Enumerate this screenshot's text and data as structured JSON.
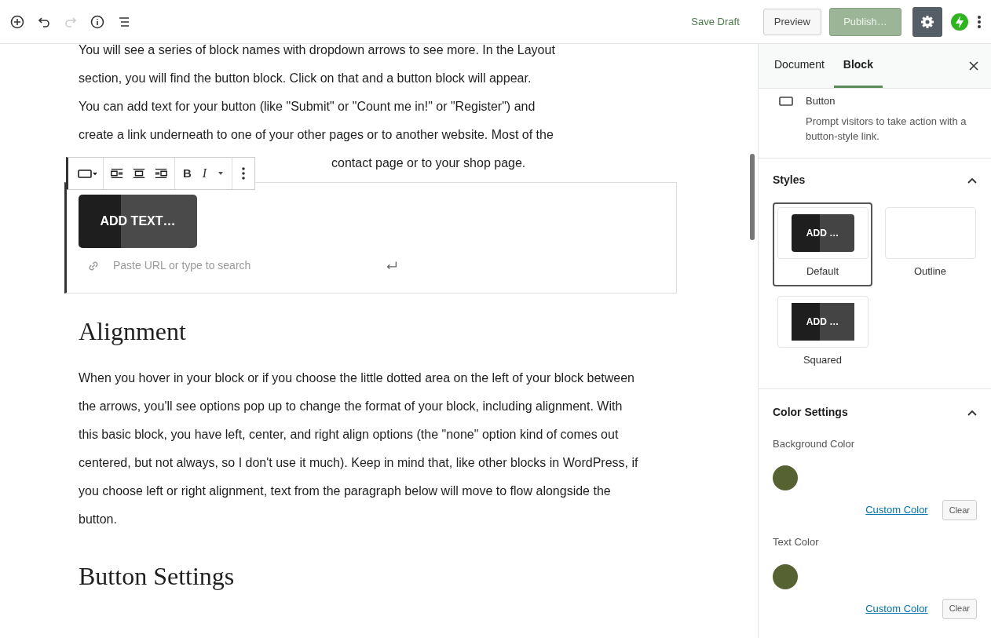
{
  "top_bar": {
    "undo_disabled": false,
    "redo_disabled": true,
    "save_draft": "Save Draft",
    "preview": "Preview",
    "publish": {
      "label": "Publish…",
      "disabled": true
    },
    "settings_active": true
  },
  "editor": {
    "paragraph_lines": [
      "You will see a series of block names with dropdown arrows to see more. In the Layout",
      "section, you will find the button block. Click on that and a button block will appear.",
      "You can add text for your button (like \"Submit\" or \"Count me in!\" or \"Register\") and",
      "create a link underneath to one of your other pages or to another website. Most of the"
    ],
    "partial_line": "contact page or to your shop page.",
    "block_toolbar": {
      "bold": "B",
      "italic": "I"
    },
    "button_block": {
      "text": "ADD TEXT…",
      "url_placeholder": "Paste URL or type to search"
    },
    "sections": [
      {
        "heading": "Alignment",
        "text": "When you hover in your block or if you choose the little dotted area on the left of your block between the arrows, you'll see options pop up to change the format of your block, including alignment. With this basic block, you have left, center, and right align options (the \"none\" option kind of comes out centered, but not always, so I don't use it much). Keep in mind that, like other blocks in WordPress, if you choose left or right alignment, text from the paragraph below will move to flow alongside the button."
      },
      {
        "heading": "Button Settings"
      }
    ]
  },
  "sidebar": {
    "tabs": [
      {
        "label": "Document",
        "selected": false
      },
      {
        "label": "Block",
        "selected": true
      }
    ],
    "block_card": {
      "title": "Button",
      "description": "Prompt visitors to take action with a button-style link."
    },
    "styles": {
      "title": "Styles",
      "expanded": true,
      "options": [
        {
          "label": "Default",
          "kind": "fill",
          "preview": "ADD …",
          "selected": true
        },
        {
          "label": "Outline",
          "kind": "outline",
          "selected": false
        },
        {
          "label": "Squared",
          "kind": "squared",
          "preview": "ADD …",
          "selected": false
        }
      ]
    },
    "color_settings": {
      "title": "Color Settings",
      "expanded": true,
      "groups": [
        {
          "label": "Background Color",
          "color": "#566232",
          "custom": "Custom Color",
          "clear": "Clear"
        },
        {
          "label": "Text Color",
          "color": "#566232",
          "custom": "Custom Color",
          "clear": "Clear"
        }
      ]
    }
  }
}
